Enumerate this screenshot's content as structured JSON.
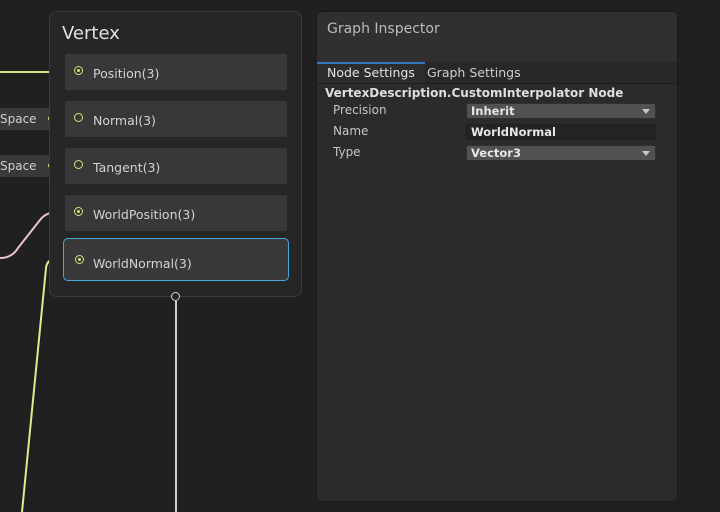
{
  "vertex_node": {
    "title": "Vertex",
    "blocks": [
      {
        "label": "Position(3)"
      },
      {
        "label": "Normal(3)"
      },
      {
        "label": "Tangent(3)"
      },
      {
        "label": "WorldPosition(3)"
      },
      {
        "label": "WorldNormal(3)"
      }
    ]
  },
  "external_ports": [
    {
      "label": "Space"
    },
    {
      "label": "Space"
    }
  ],
  "inspector": {
    "title": "Graph Inspector",
    "tabs": [
      {
        "label": "Node Settings"
      },
      {
        "label": "Graph Settings"
      }
    ],
    "node_heading": "VertexDescription.CustomInterpolator Node",
    "fields": {
      "precision": {
        "label": "Precision",
        "value": "Inherit"
      },
      "name": {
        "label": "Name",
        "value": "WorldNormal"
      },
      "type": {
        "label": "Type",
        "value": "Vector3"
      }
    }
  },
  "colors": {
    "port_yellow": "#d8e07a",
    "wire_pink": "#e8c4c4",
    "selection_blue": "#45a8dc",
    "tab_accent": "#3a79bb"
  }
}
